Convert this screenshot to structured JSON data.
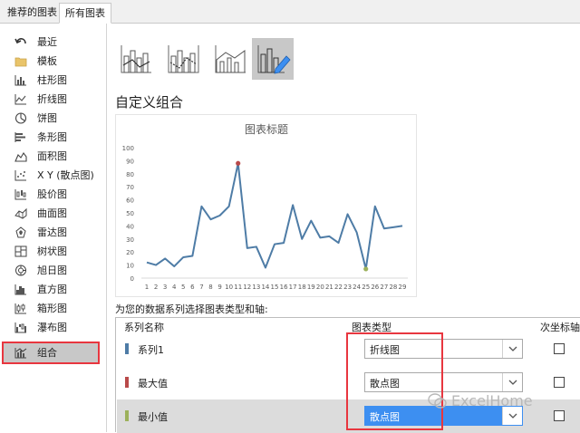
{
  "tabs": [
    {
      "label": "推荐的图表"
    },
    {
      "label": "所有图表"
    }
  ],
  "sidebar": {
    "items": [
      {
        "label": "最近",
        "icon": "undo-arrow-icon"
      },
      {
        "label": "模板",
        "icon": "folder-icon"
      },
      {
        "label": "柱形图",
        "icon": "column-chart-icon"
      },
      {
        "label": "折线图",
        "icon": "line-chart-icon"
      },
      {
        "label": "饼图",
        "icon": "pie-chart-icon"
      },
      {
        "label": "条形图",
        "icon": "bar-chart-icon"
      },
      {
        "label": "面积图",
        "icon": "area-chart-icon"
      },
      {
        "label": "X Y (散点图)",
        "icon": "scatter-chart-icon"
      },
      {
        "label": "股价图",
        "icon": "stock-chart-icon"
      },
      {
        "label": "曲面图",
        "icon": "surface-chart-icon"
      },
      {
        "label": "雷达图",
        "icon": "radar-chart-icon"
      },
      {
        "label": "树状图",
        "icon": "treemap-icon"
      },
      {
        "label": "旭日图",
        "icon": "sunburst-icon"
      },
      {
        "label": "直方图",
        "icon": "histogram-icon"
      },
      {
        "label": "箱形图",
        "icon": "box-whisker-icon"
      },
      {
        "label": "瀑布图",
        "icon": "waterfall-icon"
      },
      {
        "label": "组合",
        "icon": "combo-chart-icon",
        "selected": true
      }
    ]
  },
  "subtypes": [
    {
      "icon": "combo-column-line-icon"
    },
    {
      "icon": "combo-column-line-secondary-icon"
    },
    {
      "icon": "combo-area-column-icon"
    },
    {
      "icon": "custom-combo-icon",
      "selected": true
    }
  ],
  "section_title": "自定义组合",
  "chart_data": {
    "type": "line",
    "title": "图表标题",
    "x": [
      1,
      2,
      3,
      4,
      5,
      6,
      7,
      8,
      9,
      10,
      11,
      12,
      13,
      14,
      15,
      16,
      17,
      18,
      19,
      20,
      21,
      22,
      23,
      24,
      25,
      26,
      27,
      28,
      29
    ],
    "series": [
      {
        "name": "系列1",
        "values": [
          12,
          10,
          15,
          9,
          16,
          17,
          55,
          45,
          48,
          55,
          88,
          23,
          24,
          8,
          26,
          27,
          56,
          30,
          44,
          31,
          32,
          27,
          49,
          35,
          7,
          55,
          38,
          39,
          40
        ],
        "color": "#4e7ca6"
      }
    ],
    "markers": [
      {
        "name": "最大值",
        "x": 11,
        "y": 88,
        "color": "#b94a4a"
      },
      {
        "name": "最小值",
        "x": 25,
        "y": 7,
        "color": "#9cb15b"
      }
    ],
    "ylim": [
      0,
      100
    ],
    "yticks": [
      0,
      10,
      20,
      30,
      40,
      50,
      60,
      70,
      80,
      90,
      100
    ],
    "grid": false,
    "xlabel": "",
    "ylabel": ""
  },
  "prompt": "为您的数据系列选择图表类型和轴:",
  "table": {
    "col_name": "系列名称",
    "col_type": "图表类型",
    "col_axis": "次坐标轴",
    "rows": [
      {
        "name": "系列1",
        "type": "折线图",
        "color": "#4e7ca6"
      },
      {
        "name": "最大值",
        "type": "散点图",
        "color": "#b94a4a"
      },
      {
        "name": "最小值",
        "type": "散点图",
        "color": "#9cb15b"
      }
    ]
  },
  "watermark": "ExcelHome",
  "colors": {
    "accent_selection": "#3d8ff1",
    "highlight_outline": "#e8363f",
    "line_series": "#4e7ca6"
  }
}
